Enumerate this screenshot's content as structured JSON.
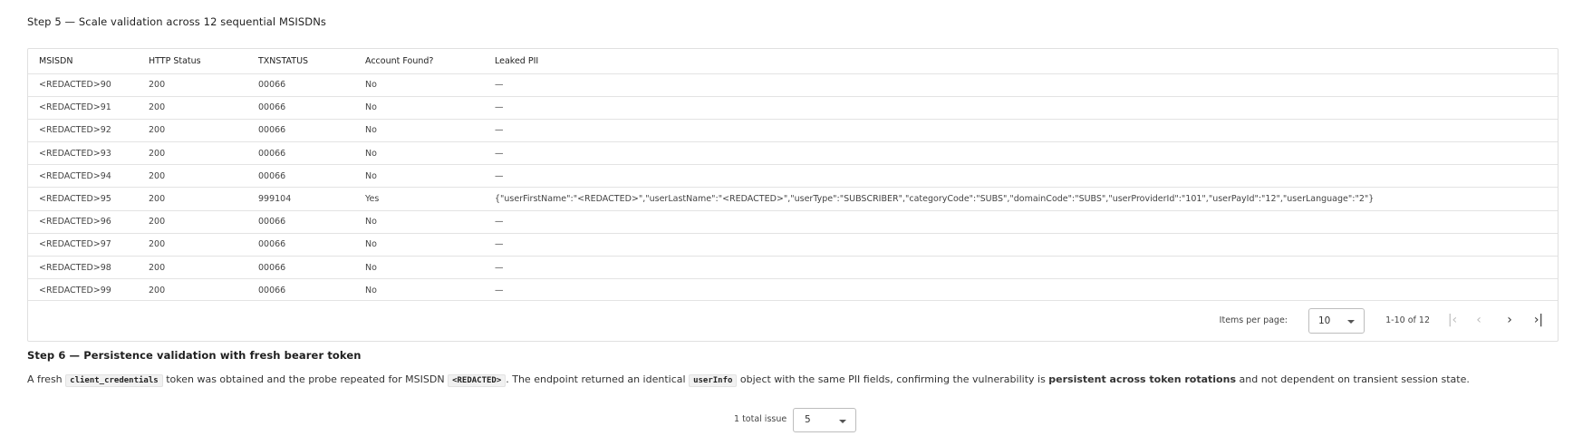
{
  "step5": {
    "title": "Step 5 — Scale validation across 12 sequential MSISDNs"
  },
  "table": {
    "headers": [
      "MSISDN",
      "HTTP Status",
      "TXNSTATUS",
      "Account Found?",
      "Leaked PII"
    ],
    "rows": [
      [
        "<REDACTED>90",
        "200",
        "00066",
        "No",
        "—"
      ],
      [
        "<REDACTED>91",
        "200",
        "00066",
        "No",
        "—"
      ],
      [
        "<REDACTED>92",
        "200",
        "00066",
        "No",
        "—"
      ],
      [
        "<REDACTED>93",
        "200",
        "00066",
        "No",
        "—"
      ],
      [
        "<REDACTED>94",
        "200",
        "00066",
        "No",
        "—"
      ],
      [
        "<REDACTED>95",
        "200",
        "999104",
        "Yes",
        "{\"userFirstName\":\"<REDACTED>\",\"userLastName\":\"<REDACTED>\",\"userType\":\"SUBSCRIBER\",\"categoryCode\":\"SUBS\",\"domainCode\":\"SUBS\",\"userProviderId\":\"101\",\"userPayId\":\"12\",\"userLanguage\":\"2\"}"
      ],
      [
        "<REDACTED>96",
        "200",
        "00066",
        "No",
        "—"
      ],
      [
        "<REDACTED>97",
        "200",
        "00066",
        "No",
        "—"
      ],
      [
        "<REDACTED>98",
        "200",
        "00066",
        "No",
        "—"
      ],
      [
        "<REDACTED>99",
        "200",
        "00066",
        "No",
        "—"
      ]
    ]
  },
  "paginator": {
    "items_per_page_label": "Items per page:",
    "items_per_page_value": "10",
    "range_label": "1-10 of 12",
    "first_icon": "first-page-icon",
    "prev_icon": "chevron-left-icon",
    "next_icon": "chevron-right-icon",
    "last_icon": "last-page-icon"
  },
  "step6": {
    "title": "Step 6 — Persistence validation with fresh bearer token",
    "para": {
      "t1": "A fresh ",
      "code1": "client_credentials",
      "t2": " token was obtained and the probe repeated for MSISDN ",
      "code2": "<REDACTED>",
      "t3": ". The endpoint returned an identical ",
      "code3": "userInfo",
      "t4": " object with the same PII fields, confirming the vulnerability is ",
      "bold": "persistent across token rotations",
      "t5": " and not dependent on transient session state."
    }
  },
  "issues": {
    "label": "1 total issue",
    "select_value": "5"
  }
}
